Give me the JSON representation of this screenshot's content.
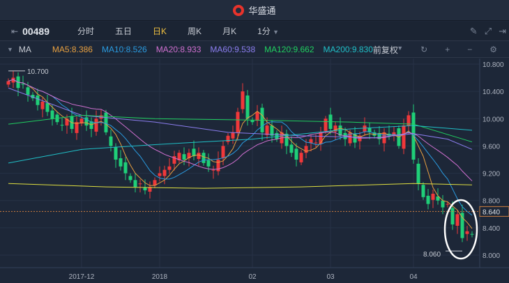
{
  "app": {
    "title": "华盛通"
  },
  "toolbar": {
    "code": "00489",
    "tabs": [
      "分时",
      "五日",
      "日K",
      "周K",
      "月K",
      "1分"
    ],
    "active": "日K"
  },
  "ma_bar": {
    "label": "MA",
    "items": [
      {
        "text": "MA5:8.386",
        "color": "#e8a040"
      },
      {
        "text": "MA10:8.526",
        "color": "#2a9be0"
      },
      {
        "text": "MA20:8.933",
        "color": "#d070d0"
      },
      {
        "text": "MA60:9.538",
        "color": "#8c7ef0"
      },
      {
        "text": "MA120:9.662",
        "color": "#20d060"
      },
      {
        "text": "MA200:9.830",
        "color": "#20c0c8"
      }
    ],
    "adjust": "前复权"
  },
  "chart_data": {
    "type": "candlestick",
    "y_ticks": [
      "10.800",
      "10.400",
      "10.000",
      "9.600",
      "9.200",
      "8.800",
      "8.400",
      "8.000"
    ],
    "ylim": [
      7.9,
      10.9
    ],
    "x_labels": [
      {
        "text": "2017-12",
        "i": 15
      },
      {
        "text": "2018",
        "i": 31
      },
      {
        "text": "02",
        "i": 50
      },
      {
        "text": "03",
        "i": 66
      },
      {
        "text": "04",
        "i": 83
      }
    ],
    "current_price": "8.640",
    "high_label": "10.700",
    "low_label": "8.060",
    "closes": [
      10.55,
      10.6,
      10.45,
      10.5,
      10.35,
      10.3,
      10.2,
      10.25,
      10.1,
      10.0,
      9.95,
      9.9,
      10.0,
      9.85,
      9.95,
      10.0,
      9.9,
      9.85,
      10.0,
      10.05,
      9.8,
      9.6,
      9.4,
      9.3,
      9.2,
      9.1,
      9.0,
      9.05,
      8.95,
      9.0,
      9.1,
      9.2,
      9.25,
      9.3,
      9.45,
      9.5,
      9.4,
      9.5,
      9.45,
      9.5,
      9.35,
      9.3,
      9.25,
      9.4,
      9.6,
      9.75,
      9.8,
      10.1,
      10.4,
      10.0,
      9.95,
      10.1,
      9.8,
      9.9,
      9.75,
      9.7,
      9.8,
      9.6,
      9.5,
      9.4,
      9.5,
      9.6,
      9.7,
      9.65,
      9.8,
      10.0,
      9.85,
      9.9,
      9.75,
      9.7,
      9.8,
      9.65,
      9.75,
      9.9,
      9.8,
      9.75,
      9.7,
      9.8,
      9.75,
      9.8,
      9.6,
      9.9,
      10.05,
      9.4,
      9.05,
      8.85,
      8.75,
      8.9,
      8.8,
      8.7,
      8.75,
      8.45,
      8.6,
      8.25,
      8.35,
      8.3
    ],
    "long_ma": [
      {
        "name": "MA60",
        "color": "#8c7ef0",
        "points": [
          [
            0,
            10.45
          ],
          [
            15,
            10.05
          ],
          [
            30,
            9.95
          ],
          [
            45,
            9.8
          ],
          [
            60,
            9.75
          ],
          [
            75,
            9.72
          ],
          [
            83,
            9.78
          ],
          [
            90,
            9.7
          ],
          [
            95,
            9.55
          ]
        ]
      },
      {
        "name": "MA120",
        "color": "#20d060",
        "points": [
          [
            0,
            9.92
          ],
          [
            15,
            10.05
          ],
          [
            30,
            10.0
          ],
          [
            50,
            9.98
          ],
          [
            70,
            9.95
          ],
          [
            83,
            9.92
          ],
          [
            95,
            9.66
          ]
        ]
      },
      {
        "name": "MA200",
        "color": "#20c0c8",
        "points": [
          [
            0,
            9.35
          ],
          [
            15,
            9.55
          ],
          [
            30,
            9.62
          ],
          [
            50,
            9.7
          ],
          [
            70,
            9.85
          ],
          [
            83,
            9.9
          ],
          [
            95,
            9.83
          ]
        ]
      },
      {
        "name": "MA250",
        "color": "#e0e040",
        "points": [
          [
            0,
            9.05
          ],
          [
            20,
            9.0
          ],
          [
            40,
            8.98
          ],
          [
            60,
            9.0
          ],
          [
            83,
            9.05
          ],
          [
            95,
            9.03
          ]
        ]
      }
    ]
  }
}
